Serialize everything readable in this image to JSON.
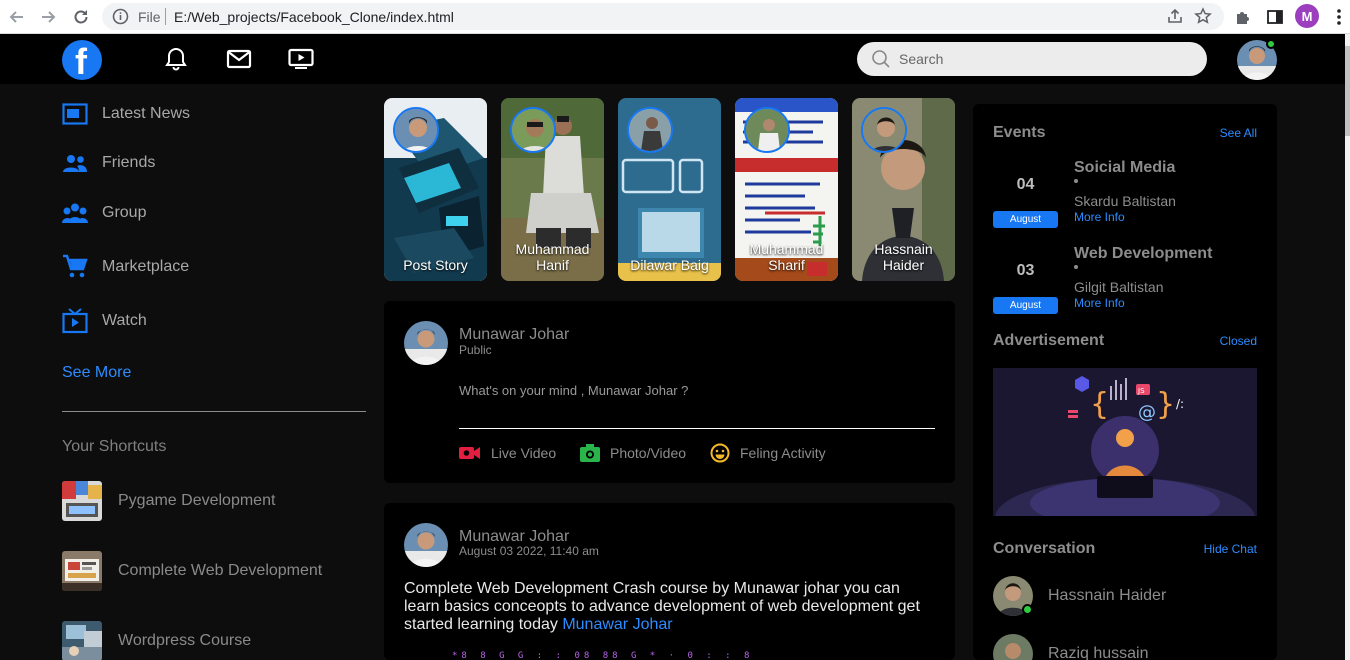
{
  "browser": {
    "scheme": "File",
    "url": "E:/Web_projects/Facebook_Clone/index.html",
    "profile_initial": "M"
  },
  "topnav": {
    "logo": "f",
    "search_placeholder": "Search"
  },
  "sidebar": {
    "items": [
      {
        "label": "Latest News",
        "icon": "news-icon"
      },
      {
        "label": "Friends",
        "icon": "friends-icon"
      },
      {
        "label": "Group",
        "icon": "group-icon"
      },
      {
        "label": "Marketplace",
        "icon": "cart-icon"
      },
      {
        "label": "Watch",
        "icon": "tv-icon"
      }
    ],
    "see_more": "See More",
    "shortcuts_title": "Your Shortcuts",
    "shortcuts": [
      {
        "label": "Pygame Development"
      },
      {
        "label": "Complete Web Development"
      },
      {
        "label": "Wordpress Course"
      }
    ]
  },
  "stories": [
    {
      "name": "Post Story"
    },
    {
      "name": "Muhammad Hanif"
    },
    {
      "name": "Dilawar Baig"
    },
    {
      "name": "Muhammad Sharif"
    },
    {
      "name": "Hassnain Haider"
    }
  ],
  "composer": {
    "name": "Munawar Johar",
    "visibility": "Public",
    "prompt": "What's on your mind , Munawar Johar ?",
    "actions": [
      {
        "label": "Live Video",
        "icon": "live-video-icon",
        "color": "#e41e3f"
      },
      {
        "label": "Photo/Video",
        "icon": "camera-icon",
        "color": "#2ab54a"
      },
      {
        "label": "Feling Activity",
        "icon": "smile-icon",
        "color": "#f7b928"
      }
    ]
  },
  "post": {
    "name": "Munawar Johar",
    "date": "August 03 2022, 11:40 am",
    "text": "Complete Web Development Crash course by Munawar johar you can learn basics conceopts to advance development of web development get started learning today ",
    "link": "Munawar Johar",
    "dots": "*8 8  G G : :   08 88   G   *  · 0 :   :   8"
  },
  "right_panel": {
    "events_title": "Events",
    "see_all": "See All",
    "events": [
      {
        "day": "04",
        "month": "August",
        "title": "Soicial Media",
        "location": "Skardu Baltistan",
        "more": "More Info"
      },
      {
        "day": "03",
        "month": "August",
        "title": "Web Development",
        "location": "Gilgit Baltistan",
        "more": "More Info"
      }
    ],
    "ad_title": "Advertisement",
    "ad_link": "Closed",
    "conv_title": "Conversation",
    "conv_link": "Hide Chat",
    "conversations": [
      {
        "name": "Hassnain Haider"
      },
      {
        "name": "Raziq hussain"
      }
    ]
  },
  "colors": {
    "accent": "#1877f2",
    "link": "#2d8cff",
    "online": "#2ecc40",
    "background": "#0d0d0d",
    "card": "#000000"
  }
}
